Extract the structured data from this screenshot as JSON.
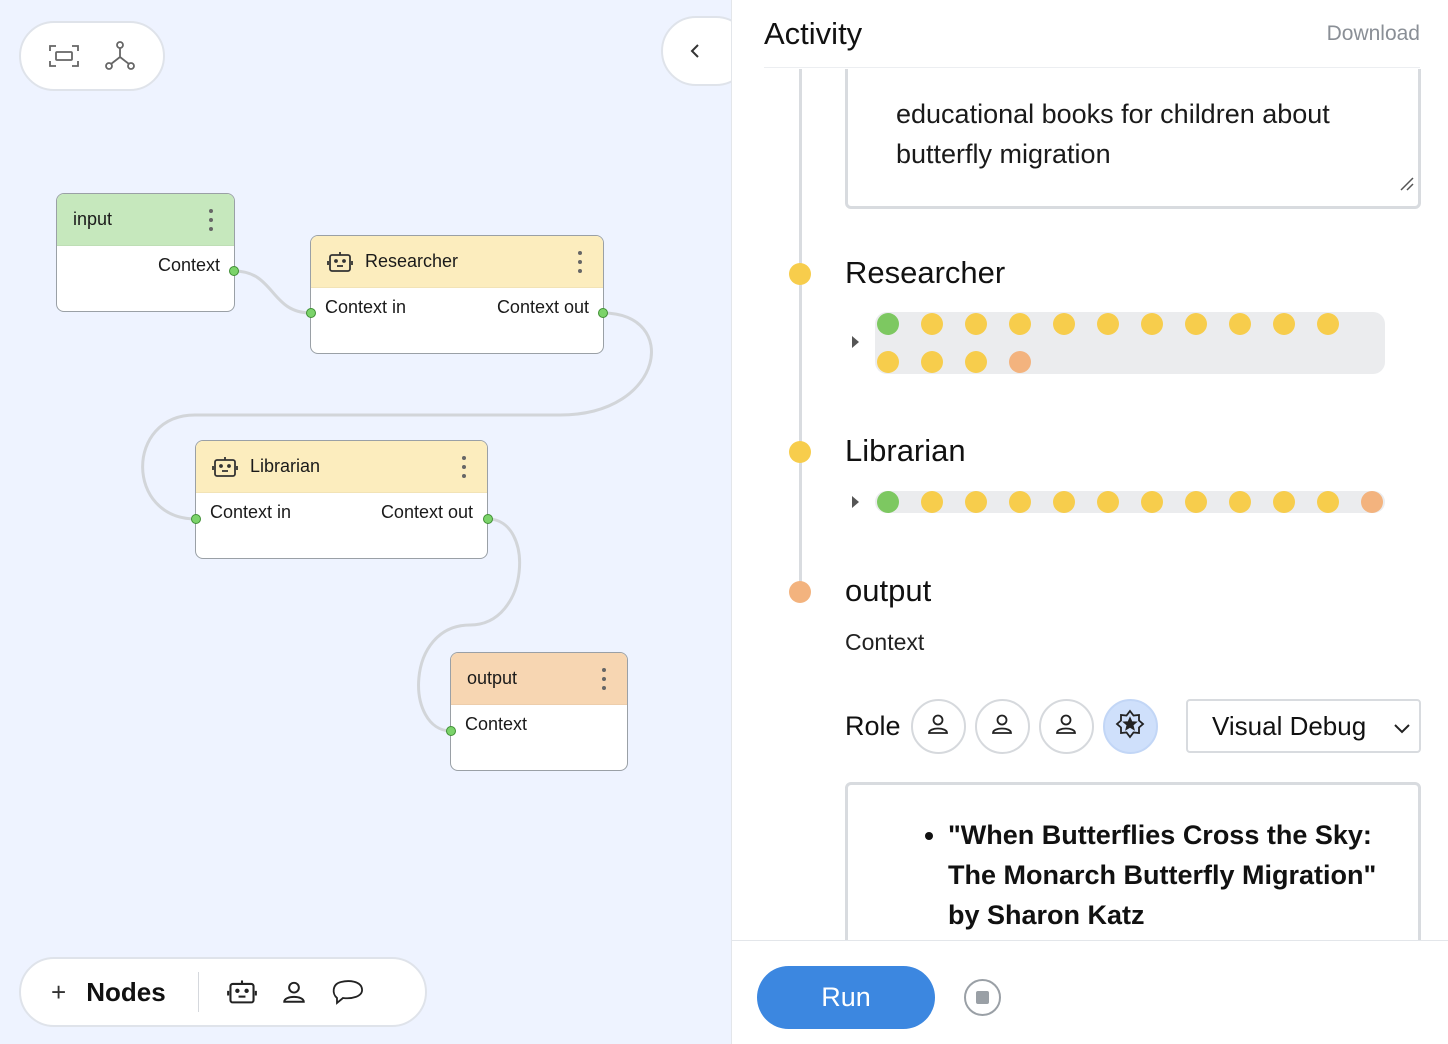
{
  "graph": {
    "nodes": {
      "input": {
        "title": "input",
        "out_port": "Context"
      },
      "researcher": {
        "title": "Researcher",
        "in_port": "Context in",
        "out_port": "Context out"
      },
      "librarian": {
        "title": "Librarian",
        "in_port": "Context in",
        "out_port": "Context out"
      },
      "output": {
        "title": "output",
        "in_port": "Context"
      }
    },
    "toolbar": {
      "add_symbol": "+",
      "nodes_label": "Nodes"
    }
  },
  "activity": {
    "title": "Activity",
    "download_label": "Download",
    "input_text": "educational books for children about butterfly migration",
    "steps": [
      {
        "name": "Researcher",
        "status": "yellow",
        "runs": [
          "green",
          "yellow",
          "yellow",
          "yellow",
          "yellow",
          "yellow",
          "yellow",
          "yellow",
          "yellow",
          "yellow",
          "yellow",
          "yellow",
          "yellow",
          "yellow",
          "orange"
        ]
      },
      {
        "name": "Librarian",
        "status": "yellow",
        "runs": [
          "green",
          "yellow",
          "yellow",
          "yellow",
          "yellow",
          "yellow",
          "yellow",
          "yellow",
          "yellow",
          "yellow",
          "yellow",
          "orange"
        ]
      },
      {
        "name": "output",
        "status": "orange",
        "runs": []
      }
    ],
    "output_context_label": "Context",
    "role_label": "Role",
    "debug_select_value": "Visual Debug",
    "result_item": "\"When Butterflies Cross the Sky: The Monarch Butterfly Migration\" by Sharon Katz",
    "run_label": "Run"
  },
  "colors": {
    "accent": "#3c87e0",
    "dot_yellow": "#f7cd4c",
    "dot_orange": "#f3b37e",
    "dot_green": "#7dc861",
    "header_input": "#c6e8bd",
    "header_agent": "#fcedbe",
    "header_output": "#f7d6b2"
  }
}
